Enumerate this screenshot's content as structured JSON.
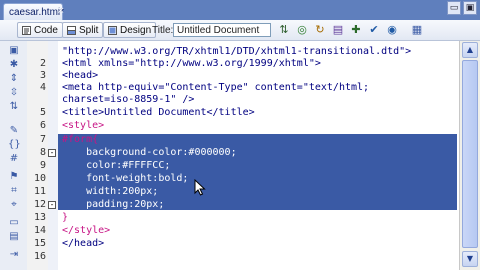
{
  "tab": {
    "label": "caesar.html*",
    "close": "×"
  },
  "window": {
    "minimize": "▭",
    "maximize": "▣"
  },
  "toolbar": {
    "code_label": "Code",
    "split_label": "Split",
    "design_label": "Design",
    "title_label": "Title:",
    "title_value": "Untitled Document"
  },
  "lines": [
    {
      "num": "",
      "text": "\"http://www.w3.org/TR/xhtml1/DTD/xhtml1-transitional.dtd\">"
    },
    {
      "num": "2",
      "text": "<html xmlns=\"http://www.w3.org/1999/xhtml\">"
    },
    {
      "num": "3",
      "text": "<head>"
    },
    {
      "num": "4",
      "text": "<meta http-equiv=\"Content-Type\" content=\"text/html;"
    },
    {
      "num": "",
      "text": "charset=iso-8859-1\" />"
    },
    {
      "num": "5",
      "text": "<title>Untitled Document</title>"
    },
    {
      "num": "6",
      "text": "<style>"
    },
    {
      "num": "7",
      "text": "#form{"
    },
    {
      "num": "8",
      "text": "    background-color:#000000;"
    },
    {
      "num": "9",
      "text": "    color:#FFFFCC;"
    },
    {
      "num": "10",
      "text": "    font-weight:bold;"
    },
    {
      "num": "11",
      "text": "    width:200px;"
    },
    {
      "num": "12",
      "text": "    padding:20px;"
    },
    {
      "num": "13",
      "text": "}"
    },
    {
      "num": "14",
      "text": "</style>"
    },
    {
      "num": "15",
      "text": "</head>"
    },
    {
      "num": "16",
      "text": ""
    }
  ]
}
